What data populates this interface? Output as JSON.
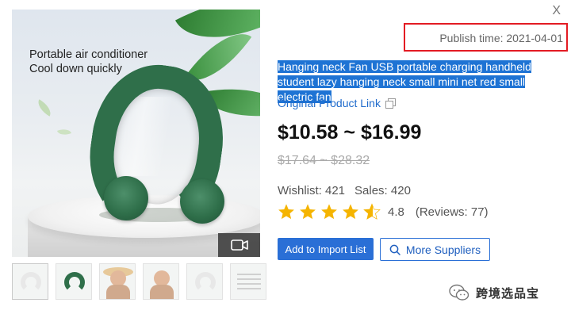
{
  "window": {
    "close_label": "X"
  },
  "gallery": {
    "ad_text_line1": "Portable air conditioner",
    "ad_text_line2": "Cool down quickly",
    "thumbnail_count": 6
  },
  "product": {
    "publish_time": "Publish time: 2021-04-01",
    "title": "Hanging neck Fan USB portable charging handheld student lazy hanging neck small mini net red small electric fan",
    "original_link_label": "Original Product Link",
    "price": "$10.58 ~ $16.99",
    "original_price": "$17.64 ~ $28.32",
    "wishlist": "Wishlist: 421",
    "sales": "Sales: 420",
    "rating": 4.8,
    "rating_label": "4.8",
    "reviews": "(Reviews: 77)"
  },
  "actions": {
    "add_to_import_label": "Add to Import List",
    "more_suppliers_label": "More Suppliers"
  },
  "watermark": {
    "text": "跨境选品宝"
  },
  "colors": {
    "accent": "#2a6fd6",
    "highlight": "#1e73d4",
    "star": "#f5b400",
    "red_box": "#e31b23"
  }
}
